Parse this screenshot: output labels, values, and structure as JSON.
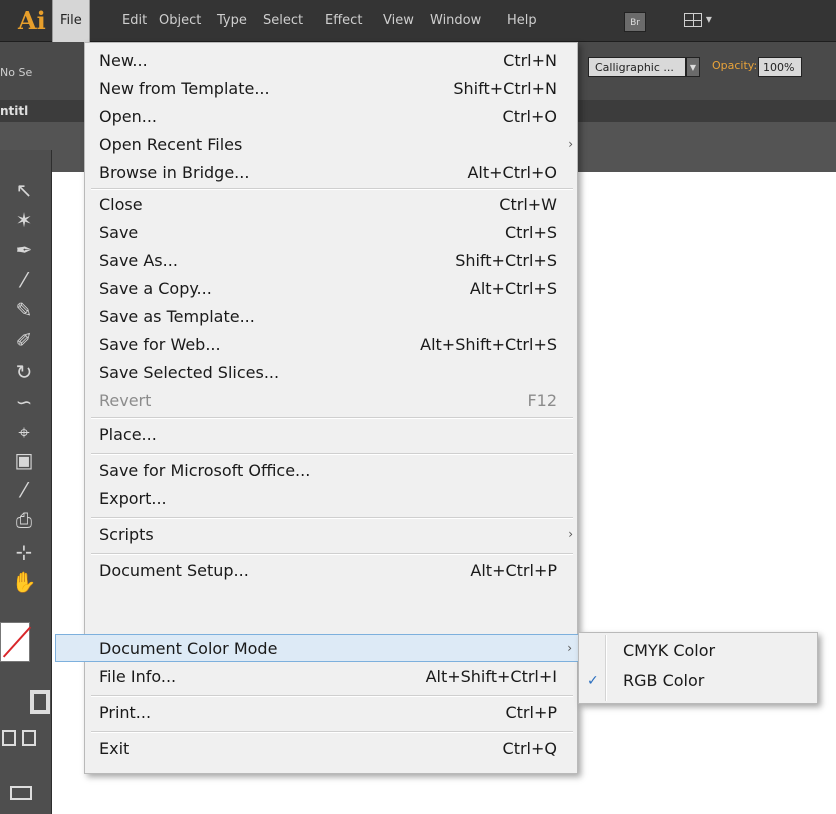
{
  "app": {
    "logo_text": "Ai",
    "accent_color": "#e79f2b"
  },
  "menubar": {
    "items": [
      "File",
      "Edit",
      "Object",
      "Type",
      "Select",
      "Effect",
      "View",
      "Window",
      "Help"
    ],
    "bridge_label": "Br",
    "workspace_arrow": "▾"
  },
  "controlbar": {
    "selection_text": "No Se",
    "brush_value": "Calligraphic ...",
    "opacity_label": "Opacity:",
    "opacity_value": "100%"
  },
  "document": {
    "tab_title": "ntitl"
  },
  "file_menu": {
    "items": [
      {
        "label": "New...",
        "shortcut": "Ctrl+N"
      },
      {
        "label": "New from Template...",
        "shortcut": "Shift+Ctrl+N"
      },
      {
        "label": "Open...",
        "shortcut": "Ctrl+O"
      },
      {
        "label": "Open Recent Files",
        "shortcut": "",
        "submenu": true
      },
      {
        "label": "Browse in Bridge...",
        "shortcut": "Alt+Ctrl+O"
      },
      {
        "label": "Close",
        "shortcut": "Ctrl+W"
      },
      {
        "label": "Save",
        "shortcut": "Ctrl+S"
      },
      {
        "label": "Save As...",
        "shortcut": "Shift+Ctrl+S"
      },
      {
        "label": "Save a Copy...",
        "shortcut": "Alt+Ctrl+S"
      },
      {
        "label": "Save as Template...",
        "shortcut": ""
      },
      {
        "label": "Save for Web...",
        "shortcut": "Alt+Shift+Ctrl+S"
      },
      {
        "label": "Save Selected Slices...",
        "shortcut": ""
      },
      {
        "label": "Revert",
        "shortcut": "F12",
        "disabled": true
      },
      {
        "label": "Place...",
        "shortcut": ""
      },
      {
        "label": "Save for Microsoft Office...",
        "shortcut": ""
      },
      {
        "label": "Export...",
        "shortcut": ""
      },
      {
        "label": "Scripts",
        "shortcut": "",
        "submenu": true
      },
      {
        "label": "Document Setup...",
        "shortcut": "Alt+Ctrl+P"
      },
      {
        "label": "Document Color Mode",
        "shortcut": "",
        "submenu": true,
        "highlighted": true
      },
      {
        "label": "File Info...",
        "shortcut": "Alt+Shift+Ctrl+I"
      },
      {
        "label": "Print...",
        "shortcut": "Ctrl+P"
      },
      {
        "label": "Exit",
        "shortcut": "Ctrl+Q"
      }
    ],
    "submenu_arrow": "›"
  },
  "color_mode_submenu": {
    "items": [
      {
        "label": "CMYK Color",
        "checked": false
      },
      {
        "label": "RGB Color",
        "checked": true
      }
    ],
    "check_glyph": "✓"
  },
  "colors": {
    "menu_bg": "#f0f0f0",
    "highlight_bg": "#ddeaf6",
    "highlight_border": "#7db0dd",
    "app_chrome": "#343434"
  }
}
